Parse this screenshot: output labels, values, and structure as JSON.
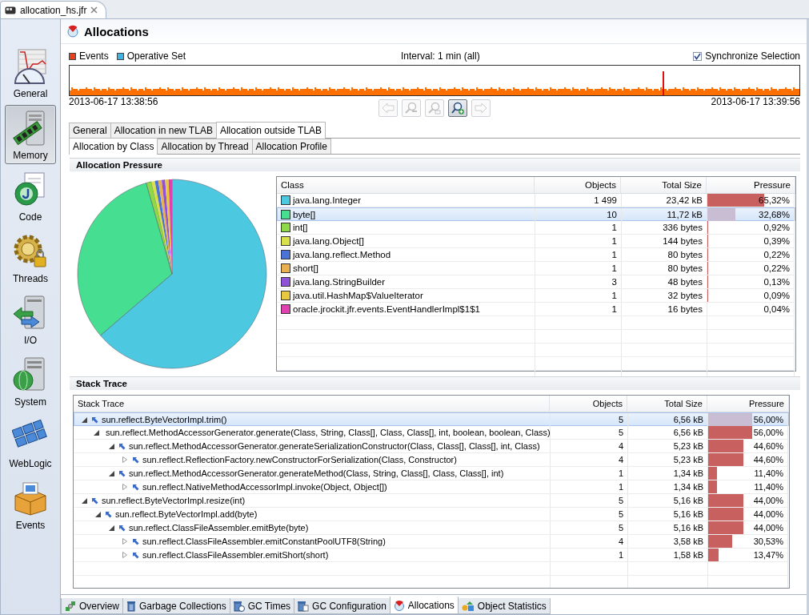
{
  "editor_tab": {
    "title": "allocation_hs.jfr"
  },
  "sidebar": {
    "items": [
      {
        "label": "General",
        "kind": "general",
        "selected": false
      },
      {
        "label": "Memory",
        "kind": "memory",
        "selected": true
      },
      {
        "label": "Code",
        "kind": "code",
        "selected": false
      },
      {
        "label": "Threads",
        "kind": "threads",
        "selected": false
      },
      {
        "label": "I/O",
        "kind": "io",
        "selected": false
      },
      {
        "label": "System",
        "kind": "system",
        "selected": false
      },
      {
        "label": "WebLogic",
        "kind": "weblogic",
        "selected": false
      },
      {
        "label": "Events",
        "kind": "events",
        "selected": false
      }
    ]
  },
  "page": {
    "title": "Allocations"
  },
  "timeline": {
    "legend": [
      {
        "label": "Events",
        "color": "#e8401c"
      },
      {
        "label": "Operative Set",
        "color": "#3cb4e6"
      }
    ],
    "interval": "Interval: 1 min (all)",
    "synchronize": {
      "label": "Synchronize Selection",
      "checked": true
    },
    "start": "2013-06-17 13:38:56",
    "end": "2013-06-17 13:39:56",
    "buttons": [
      {
        "kind": "back",
        "disabled": true
      },
      {
        "kind": "zoom-out",
        "disabled": true
      },
      {
        "kind": "zoom-reset",
        "disabled": true
      },
      {
        "kind": "zoom-in",
        "disabled": false
      },
      {
        "kind": "forward",
        "disabled": true
      }
    ]
  },
  "tabs": [
    {
      "label": "General",
      "selected": false
    },
    {
      "label": "Allocation in new TLAB",
      "selected": false
    },
    {
      "label": "Allocation outside TLAB",
      "selected": true
    }
  ],
  "subtabs": [
    {
      "label": "Allocation by Class",
      "selected": true
    },
    {
      "label": "Allocation by Thread",
      "selected": false
    },
    {
      "label": "Allocation Profile",
      "selected": false
    }
  ],
  "allocation_pressure": {
    "title": "Allocation Pressure",
    "columns": [
      "Class",
      "Objects",
      "Total Size",
      "Pressure"
    ],
    "rows": [
      {
        "class": "java.lang.Integer",
        "color": "#4cc8e0",
        "objects": "1 499",
        "total_size": "23,42 kB",
        "pressure": "65,32%",
        "level": 0.6532,
        "selected": false
      },
      {
        "class": "byte[]",
        "color": "#46de90",
        "objects": "10",
        "total_size": "11,72 kB",
        "pressure": "32,68%",
        "level": 0.3268,
        "selected": true
      },
      {
        "class": "int[]",
        "color": "#8ed84a",
        "objects": "1",
        "total_size": "336 bytes",
        "pressure": "0,92%",
        "level": 0.0092,
        "selected": false
      },
      {
        "class": "java.lang.Object[]",
        "color": "#d8e04a",
        "objects": "1",
        "total_size": "144 bytes",
        "pressure": "0,39%",
        "level": 0.0039,
        "selected": false
      },
      {
        "class": "java.lang.reflect.Method",
        "color": "#4a72d8",
        "objects": "1",
        "total_size": "80 bytes",
        "pressure": "0,22%",
        "level": 0.0022,
        "selected": false
      },
      {
        "class": "short[]",
        "color": "#e8b050",
        "objects": "1",
        "total_size": "80 bytes",
        "pressure": "0,22%",
        "level": 0.0022,
        "selected": false
      },
      {
        "class": "java.lang.StringBuilder",
        "color": "#9050d8",
        "objects": "3",
        "total_size": "48 bytes",
        "pressure": "0,13%",
        "level": 0.0013,
        "selected": false
      },
      {
        "class": "java.util.HashMap$ValueIterator",
        "color": "#e8c840",
        "objects": "1",
        "total_size": "32 bytes",
        "pressure": "0,09%",
        "level": 0.0009,
        "selected": false
      },
      {
        "class": "oracle.jrockit.jfr.events.EventHandlerImpl$1$1",
        "color": "#e040b0",
        "objects": "1",
        "total_size": "16 bytes",
        "pressure": "0,04%",
        "level": 0.0004,
        "selected": false
      }
    ]
  },
  "stack_trace": {
    "title": "Stack Trace",
    "columns": [
      "Stack Trace",
      "Objects",
      "Total Size",
      "Pressure"
    ],
    "rows": [
      {
        "method": "sun.reflect.ByteVectorImpl.trim()",
        "objects": "5",
        "total_size": "6,56 kB",
        "pressure": "56,00%",
        "level": 0.56,
        "expanded": true,
        "selected": true,
        "children": [
          {
            "method": "sun.reflect.MethodAccessorGenerator.generate(Class, String, Class[], Class, Class[], int, boolean, boolean, Class)",
            "objects": "5",
            "total_size": "6,56 kB",
            "pressure": "56,00%",
            "level": 0.56,
            "expanded": true,
            "selected": false,
            "children": [
              {
                "method": "sun.reflect.MethodAccessorGenerator.generateSerializationConstructor(Class, Class[], Class[], int, Class)",
                "objects": "4",
                "total_size": "5,23 kB",
                "pressure": "44,60%",
                "level": 0.446,
                "expanded": true,
                "selected": false,
                "children": [
                  {
                    "method": "sun.reflect.ReflectionFactory.newConstructorForSerialization(Class, Constructor)",
                    "objects": "4",
                    "total_size": "5,23 kB",
                    "pressure": "44,60%",
                    "level": 0.446,
                    "expanded": false,
                    "selected": false
                  }
                ]
              },
              {
                "method": "sun.reflect.MethodAccessorGenerator.generateMethod(Class, String, Class[], Class, Class[], int)",
                "objects": "1",
                "total_size": "1,34 kB",
                "pressure": "11,40%",
                "level": 0.114,
                "expanded": true,
                "selected": false,
                "children": [
                  {
                    "method": "sun.reflect.NativeMethodAccessorImpl.invoke(Object, Object[])",
                    "objects": "1",
                    "total_size": "1,34 kB",
                    "pressure": "11,40%",
                    "level": 0.114,
                    "expanded": false,
                    "selected": false
                  }
                ]
              }
            ]
          }
        ]
      },
      {
        "method": "sun.reflect.ByteVectorImpl.resize(int)",
        "objects": "5",
        "total_size": "5,16 kB",
        "pressure": "44,00%",
        "level": 0.44,
        "expanded": true,
        "selected": false,
        "children": [
          {
            "method": "sun.reflect.ByteVectorImpl.add(byte)",
            "objects": "5",
            "total_size": "5,16 kB",
            "pressure": "44,00%",
            "level": 0.44,
            "expanded": true,
            "selected": false,
            "children": [
              {
                "method": "sun.reflect.ClassFileAssembler.emitByte(byte)",
                "objects": "5",
                "total_size": "5,16 kB",
                "pressure": "44,00%",
                "level": 0.44,
                "expanded": true,
                "selected": false,
                "children": [
                  {
                    "method": "sun.reflect.ClassFileAssembler.emitConstantPoolUTF8(String)",
                    "objects": "4",
                    "total_size": "3,58 kB",
                    "pressure": "30,53%",
                    "level": 0.3053,
                    "expanded": false,
                    "selected": false
                  },
                  {
                    "method": "sun.reflect.ClassFileAssembler.emitShort(short)",
                    "objects": "1",
                    "total_size": "1,58 kB",
                    "pressure": "13,47%",
                    "level": 0.1347,
                    "expanded": false,
                    "selected": false
                  }
                ]
              }
            ]
          }
        ]
      }
    ]
  },
  "bottom_tabs": [
    {
      "label": "Overview",
      "kind": "overview",
      "selected": false
    },
    {
      "label": "Garbage Collections",
      "kind": "gc",
      "selected": false
    },
    {
      "label": "GC Times",
      "kind": "gc-times",
      "selected": false
    },
    {
      "label": "GC Configuration",
      "kind": "gc-config",
      "selected": false
    },
    {
      "label": "Allocations",
      "kind": "allocations",
      "selected": true
    },
    {
      "label": "Object Statistics",
      "kind": "objects",
      "selected": false
    }
  ]
}
